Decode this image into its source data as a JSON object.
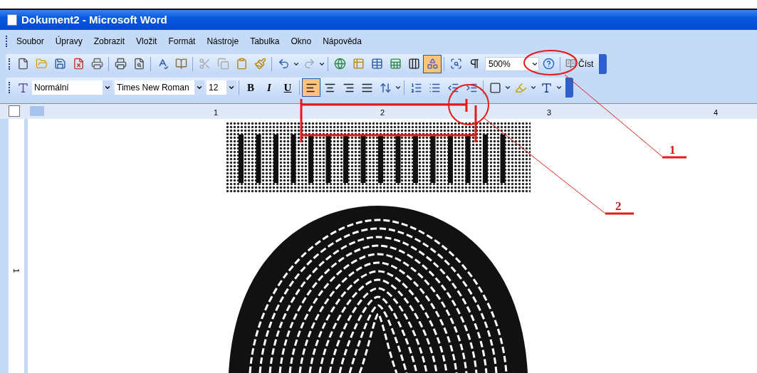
{
  "window": {
    "title": "Dokument2 - Microsoft Word"
  },
  "menu": [
    "Soubor",
    "Úpravy",
    "Zobrazit",
    "Vložit",
    "Formát",
    "Nástroje",
    "Tabulka",
    "Okno",
    "Nápověda"
  ],
  "standard_toolbar": {
    "drawing_button_on": true,
    "zoom": "500%",
    "read_button": "Číst"
  },
  "formatting_toolbar": {
    "style": "Normální",
    "font": "Times New Roman",
    "size": "12",
    "bold": "B",
    "italic": "I",
    "underline": "U",
    "alignments": [
      {
        "selected": true
      },
      {
        "selected": false
      },
      {
        "selected": false
      },
      {
        "selected": false
      }
    ]
  },
  "ruler": {
    "numbers": [
      "1",
      "2",
      "3",
      "4"
    ]
  },
  "vertical_ruler": {
    "numbers": [
      "1"
    ]
  },
  "annotations": [
    {
      "label": "1"
    },
    {
      "label": "2"
    }
  ]
}
